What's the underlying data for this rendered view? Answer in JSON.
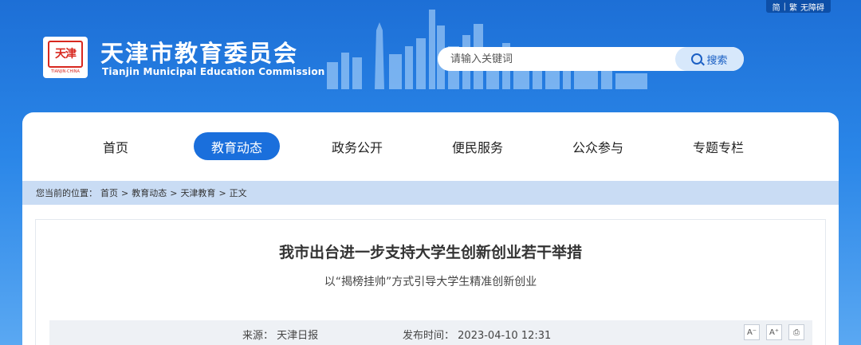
{
  "topbar": {
    "simplified": "简",
    "sep": "|",
    "traditional": "繁",
    "accessibility": "无障碍"
  },
  "logo": {
    "seal_text": "天津",
    "seal_sub": "TIANJIN·CHINA"
  },
  "header": {
    "title": "天津市教育委员会",
    "subtitle": "Tianjin Municipal Education Commission"
  },
  "search": {
    "placeholder": "请输入关键词",
    "button_label": "搜索"
  },
  "nav": {
    "items": [
      {
        "label": "首页"
      },
      {
        "label": "教育动态",
        "active": true
      },
      {
        "label": "政务公开"
      },
      {
        "label": "便民服务"
      },
      {
        "label": "公众参与"
      },
      {
        "label": "专题专栏"
      }
    ]
  },
  "breadcrumb": {
    "prefix": "您当前的位置：",
    "items": [
      "首页",
      "教育动态",
      "天津教育",
      "正文"
    ],
    "sep": ">"
  },
  "article": {
    "title": "我市出台进一步支持大学生创新创业若干举措",
    "subtitle": "以“揭榜挂帅”方式引导大学生精准创新创业",
    "source_label": "来源：",
    "source": "天津日报",
    "time_label": "发布时间：",
    "time": "2023-04-10 12:31",
    "tools": {
      "font_smaller": "A⁻",
      "font_larger": "A⁺",
      "print": "⎙"
    }
  },
  "colors": {
    "accent": "#1a6fdc",
    "header_bg": "#2a86e8",
    "breadcrumb_bg": "#c9dcf4"
  }
}
